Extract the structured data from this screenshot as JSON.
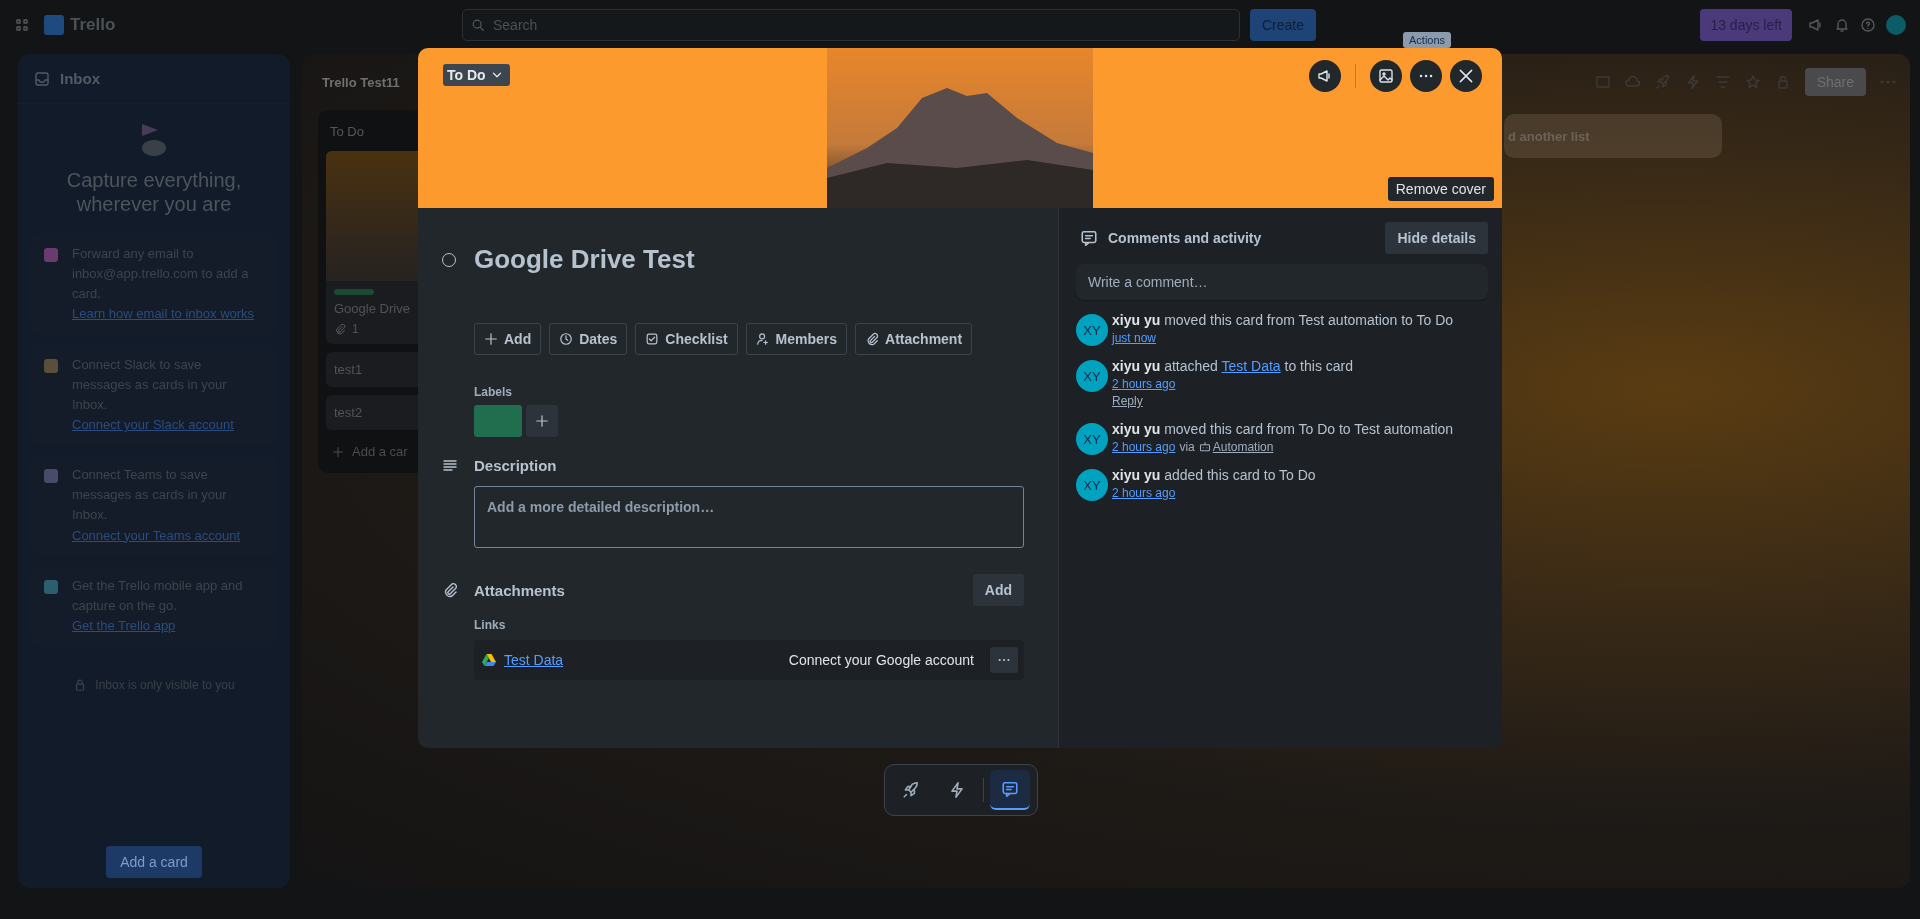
{
  "topbar": {
    "logo_text": "Trello",
    "search_placeholder": "Search",
    "create_button": "Create",
    "trial_button": "13 days left"
  },
  "inbox": {
    "title": "Inbox",
    "headline": "Capture everything, wherever you are",
    "tips": [
      {
        "kind": "email",
        "text": "Forward any email to inbox@app.trello.com to add a card.",
        "link": "Learn how email to inbox works"
      },
      {
        "kind": "slack",
        "text": "Connect Slack to save messages as cards in your Inbox.",
        "link": "Connect your Slack account"
      },
      {
        "kind": "teams",
        "text": "Connect Teams to save messages as cards in your Inbox.",
        "link": "Connect your Teams account"
      },
      {
        "kind": "mobile",
        "text": "Get the Trello mobile app and capture on the go.",
        "link": "Get the Trello app"
      }
    ],
    "footer": "Inbox is only visible to you",
    "add_button": "Add a card"
  },
  "board": {
    "title": "Trello Test11",
    "list": {
      "title": "To Do",
      "cards": [
        {
          "kind": "cover",
          "title": "Google Drive",
          "attachments": "1"
        },
        {
          "kind": "plain",
          "title": "test1"
        },
        {
          "kind": "plain",
          "title": "test2"
        }
      ],
      "add_card": "Add a car"
    },
    "add_list": "d another list",
    "share_button": "Share"
  },
  "card_modal": {
    "list_button": "To Do",
    "tooltip": "Actions",
    "remove_cover": "Remove cover",
    "title": "Google Drive Test",
    "completed": false,
    "actions": [
      {
        "kind": "add",
        "label": "Add"
      },
      {
        "kind": "dates",
        "label": "Dates"
      },
      {
        "kind": "checklist",
        "label": "Checklist"
      },
      {
        "kind": "members",
        "label": "Members"
      },
      {
        "kind": "attachment",
        "label": "Attachment"
      }
    ],
    "labels_heading": "Labels",
    "labels": [
      {
        "color": "#216e4e"
      }
    ],
    "description_heading": "Description",
    "description_placeholder": "Add a more detailed description…",
    "attachments_heading": "Attachments",
    "attachments_add": "Add",
    "links_heading": "Links",
    "links": [
      {
        "title": "Test Data",
        "action": "Connect your Google account"
      }
    ],
    "activity_heading": "Comments and activity",
    "hide_details": "Hide details",
    "comment_placeholder": "Write a comment…",
    "activity": [
      {
        "initials": "XY",
        "user": "xiyu yu",
        "parts": [
          {
            "kind": "text",
            "text": "moved this card from Test automation to To Do"
          }
        ],
        "time": "just now"
      },
      {
        "initials": "XY",
        "user": "xiyu yu",
        "parts": [
          {
            "kind": "text",
            "text": "attached"
          },
          {
            "kind": "link",
            "text": "Test Data"
          },
          {
            "kind": "text",
            "text": "to this card"
          }
        ],
        "time": "2 hours ago",
        "reply": "Reply"
      },
      {
        "initials": "XY",
        "user": "xiyu yu",
        "parts": [
          {
            "kind": "text",
            "text": "moved this card from To Do to Test automation"
          }
        ],
        "time": "2 hours ago",
        "via": "via",
        "via_link": "Automation"
      },
      {
        "initials": "XY",
        "user": "xiyu yu",
        "parts": [
          {
            "kind": "text",
            "text": "added this card to To Do"
          }
        ],
        "time": "2 hours ago"
      }
    ]
  },
  "bottom_toolbar": [
    {
      "kind": "rocket",
      "selected": false
    },
    {
      "kind": "bolt",
      "selected": false
    },
    {
      "kind": "comment",
      "selected": true
    }
  ]
}
